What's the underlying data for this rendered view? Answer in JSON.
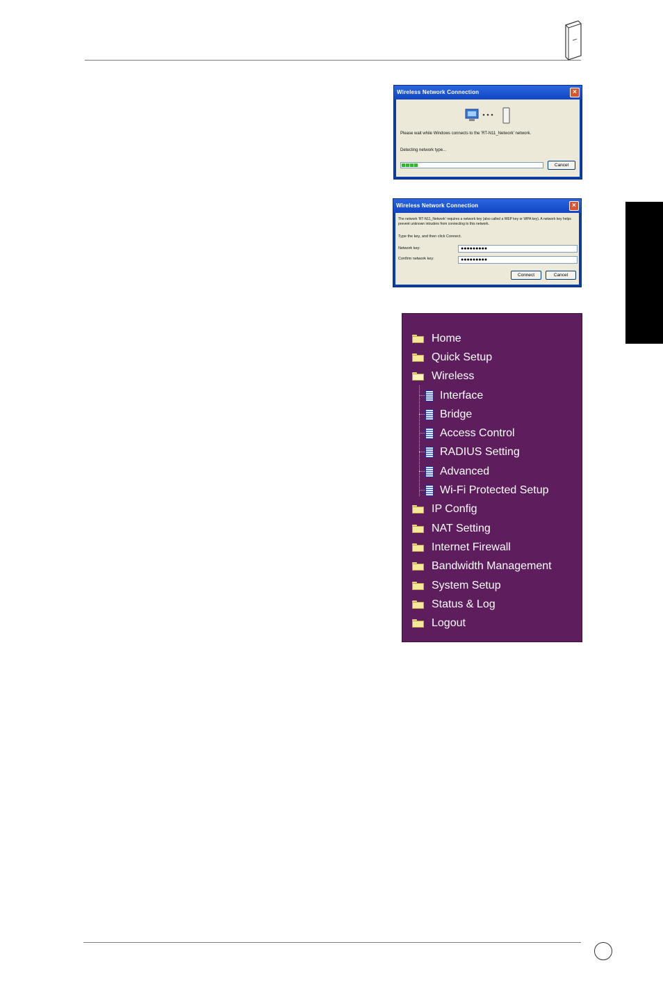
{
  "dialog1": {
    "title": "Wireless Network Connection",
    "message": "Please wait while Windows connects to the 'RT-N11_Network' network.",
    "status": "Detecting network type...",
    "progress": 0.12,
    "cancel_label": "Cancel"
  },
  "dialog2": {
    "title": "Wireless Network Connection",
    "message": "The network 'RT-N11_Network' requires a network key (also called a WEP key or WPA key). A network key helps prevent unknown intruders from connecting to this network.",
    "instruction": "Type the key, and then click Connect.",
    "network_key_label": "Network key:",
    "network_key_value": "●●●●●●●●●",
    "confirm_key_label": "Confirm network key:",
    "confirm_key_value": "●●●●●●●●●",
    "connect_label": "Connect",
    "cancel_label": "Cancel"
  },
  "menu": {
    "items": [
      {
        "label": "Home",
        "icon": "folder-icon"
      },
      {
        "label": "Quick Setup",
        "icon": "folder-icon"
      },
      {
        "label": "Wireless",
        "icon": "folder-open-icon"
      },
      {
        "label": "Interface",
        "icon": "page-icon"
      },
      {
        "label": "Bridge",
        "icon": "page-icon"
      },
      {
        "label": "Access Control",
        "icon": "page-icon"
      },
      {
        "label": "RADIUS Setting",
        "icon": "page-icon"
      },
      {
        "label": "Advanced",
        "icon": "page-icon"
      },
      {
        "label": "Wi-Fi Protected Setup",
        "icon": "page-icon"
      },
      {
        "label": "IP Config",
        "icon": "folder-icon"
      },
      {
        "label": "NAT Setting",
        "icon": "folder-icon"
      },
      {
        "label": "Internet Firewall",
        "icon": "folder-icon"
      },
      {
        "label": "Bandwidth Management",
        "icon": "folder-icon"
      },
      {
        "label": "System Setup",
        "icon": "folder-icon"
      },
      {
        "label": "Status & Log",
        "icon": "folder-icon"
      },
      {
        "label": "Logout",
        "icon": "folder-icon"
      }
    ]
  },
  "colors": {
    "menu_bg": "#5e1e5e",
    "xp_title": "#1245c2",
    "xp_face": "#ece9d8",
    "progress_green": "#2fb52f"
  }
}
